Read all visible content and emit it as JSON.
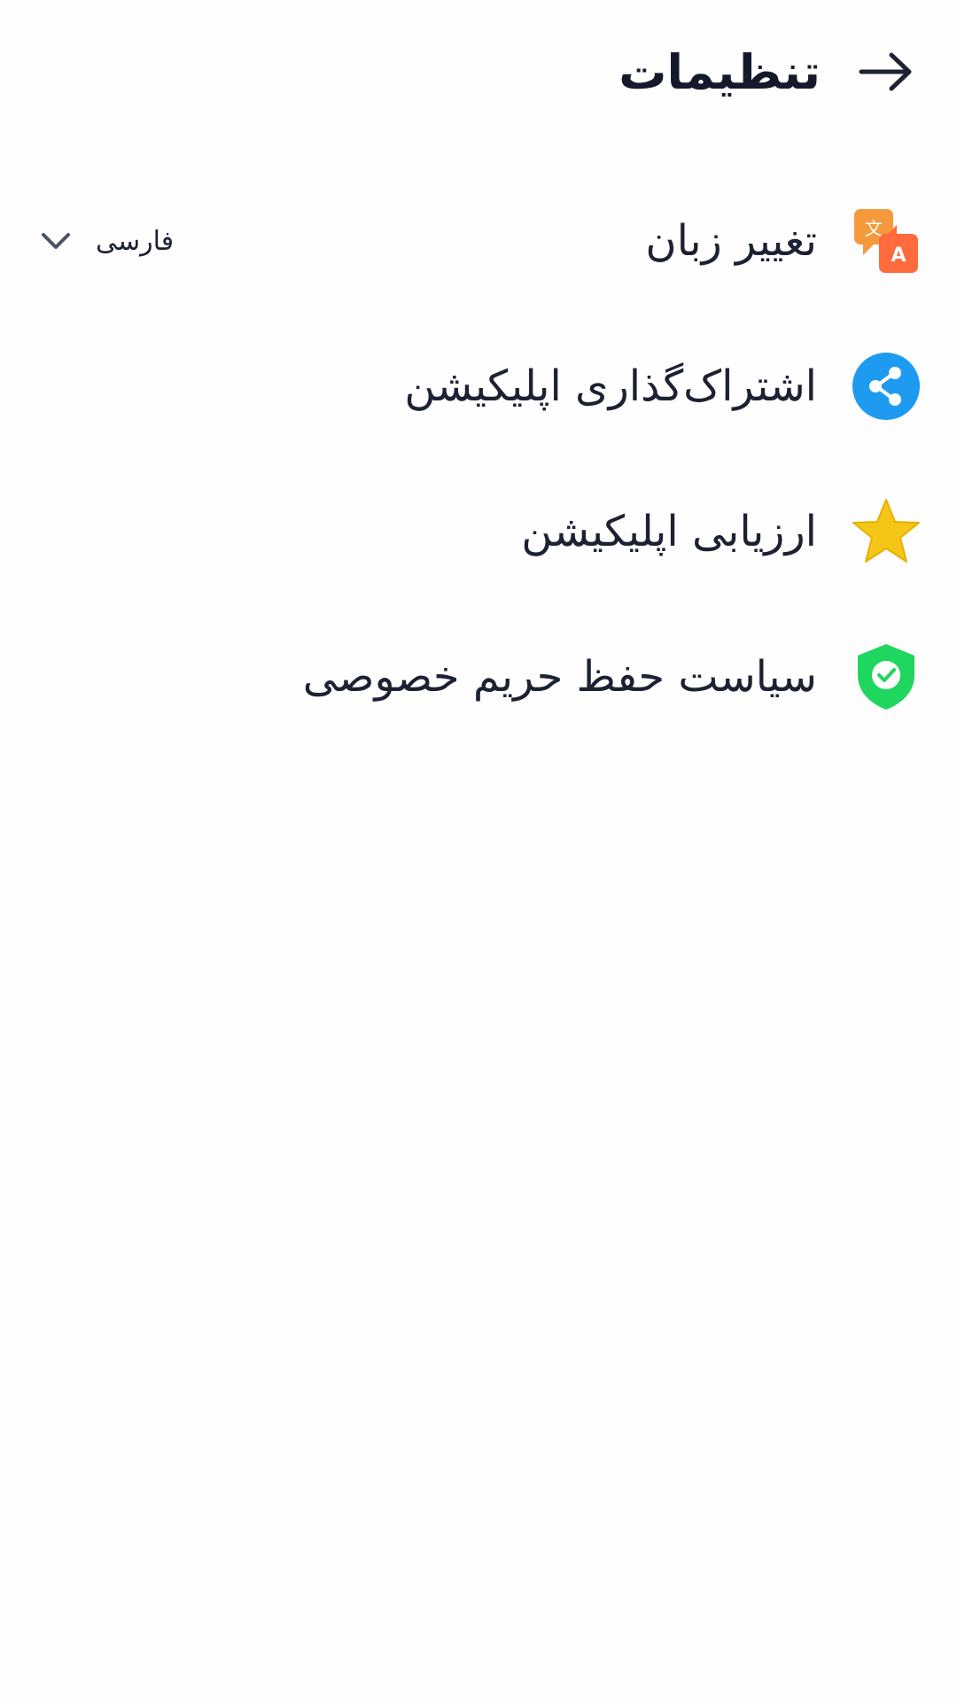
{
  "header": {
    "title": "تنظیمات",
    "back_icon": "arrow-right-icon"
  },
  "items": [
    {
      "label": "تغییر زبان",
      "icon": "translate-icon"
    },
    {
      "label": "اشتراک‌گذاری اپلیکیشن",
      "icon": "share-icon"
    },
    {
      "label": "ارزیابی اپلیکیشن",
      "icon": "star-icon"
    },
    {
      "label": "سیاست حفظ حریم خصوصی",
      "icon": "shield-check-icon"
    }
  ],
  "language": {
    "selected": "فارسی",
    "icon": "chevron-down-icon"
  },
  "colors": {
    "text": "#1c2233",
    "share_blue": "#1e9bf0",
    "star_yellow": "#f5c518",
    "shield_green": "#1fd65f",
    "translate_orange": "#f59a3c",
    "translate_red": "#ff6b3d"
  }
}
